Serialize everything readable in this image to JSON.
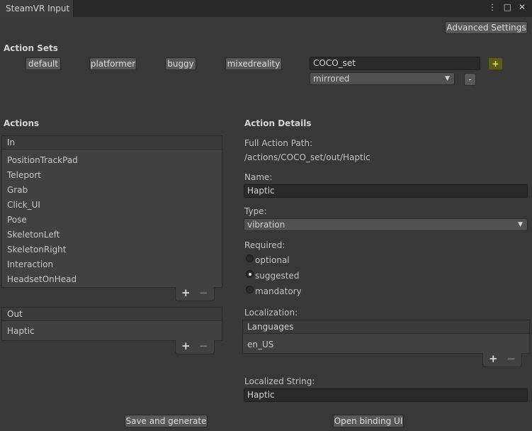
{
  "window": {
    "tab_title": "SteamVR Input",
    "tab_icons": [
      "more-vert-icon",
      "maximize-icon",
      "close-icon"
    ],
    "more_glyph": "⋮",
    "max_glyph": "□",
    "close_glyph": "✕"
  },
  "toolbar": {
    "advanced_settings": "Advanced Settings"
  },
  "action_sets": {
    "heading": "Action Sets",
    "sets": [
      "default",
      "platformer",
      "buggy",
      "mixedreality"
    ],
    "new_set_value": "COCO_set",
    "add_label": "+",
    "usage_dropdown": "mirrored",
    "remove_label": "-"
  },
  "actions": {
    "heading": "Actions",
    "in_header": "In",
    "in_items": [
      "PositionTrackPad",
      "Teleport",
      "Grab",
      "Click_UI",
      "Pose",
      "SkeletonLeft",
      "SkeletonRight",
      "Interaction",
      "HeadsetOnHead"
    ],
    "out_header": "Out",
    "out_items": [
      "Haptic"
    ],
    "plus": "+",
    "minus": "−"
  },
  "details": {
    "heading": "Action Details",
    "full_path_label": "Full Action Path:",
    "full_path_value": "/actions/COCO_set/out/Haptic",
    "name_label": "Name:",
    "name_value": "Haptic",
    "type_label": "Type:",
    "type_value": "vibration",
    "required_label": "Required:",
    "required_options": [
      "optional",
      "suggested",
      "mandatory"
    ],
    "required_selected": "suggested",
    "localization_label": "Localization:",
    "languages_header": "Languages",
    "languages": [
      "en_US"
    ],
    "localized_label": "Localized String:",
    "localized_value": "Haptic"
  },
  "bottom": {
    "save_generate": "Save and generate",
    "open_binding": "Open binding UI"
  },
  "colors": {
    "accent_add": "#5c5a1c",
    "add_text": "#e8e84a",
    "background": "#383838"
  }
}
